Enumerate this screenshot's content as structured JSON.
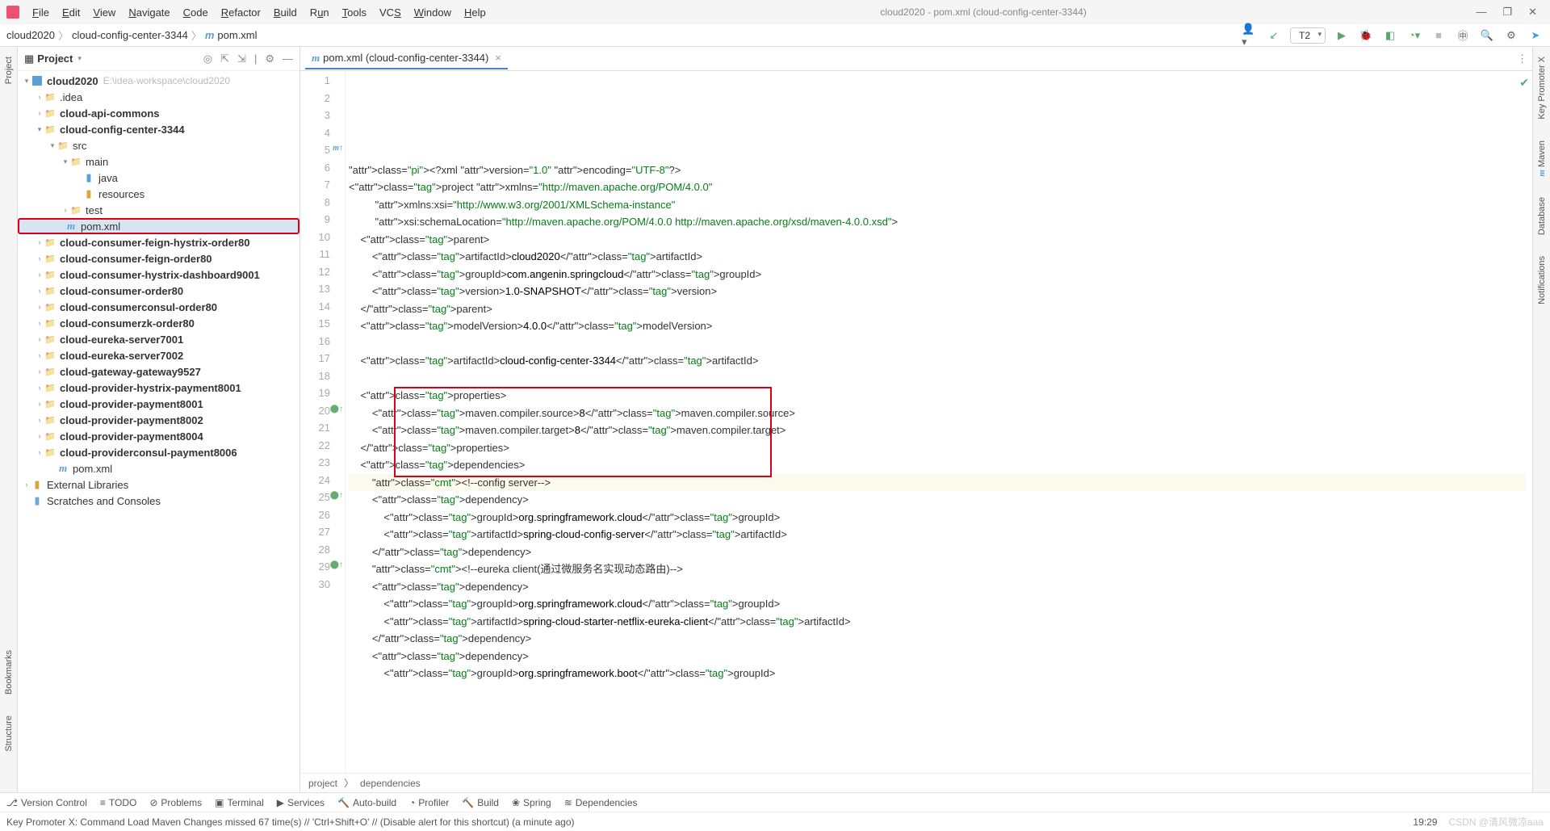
{
  "title": "cloud2020 - pom.xml (cloud-config-center-3344)",
  "menu": [
    "File",
    "Edit",
    "View",
    "Navigate",
    "Code",
    "Refactor",
    "Build",
    "Run",
    "Tools",
    "VCS",
    "Window",
    "Help"
  ],
  "breadcrumb": {
    "root": "cloud2020",
    "module": "cloud-config-center-3344",
    "file": "pom.xml"
  },
  "run_config": "T2",
  "project_label": "Project",
  "tree_root": "cloud2020",
  "tree_root_hint": "E:\\idea-workspace\\cloud2020",
  "tree": {
    "idea": ".idea",
    "api": "cloud-api-commons",
    "ccc": "cloud-config-center-3344",
    "src": "src",
    "main": "main",
    "java": "java",
    "resources": "resources",
    "test": "test",
    "pom": "pom.xml",
    "mods": [
      "cloud-consumer-feign-hystrix-order80",
      "cloud-consumer-feign-order80",
      "cloud-consumer-hystrix-dashboard9001",
      "cloud-consumer-order80",
      "cloud-consumerconsul-order80",
      "cloud-consumerzk-order80",
      "cloud-eureka-server7001",
      "cloud-eureka-server7002",
      "cloud-gateway-gateway9527",
      "cloud-provider-hystrix-payment8001",
      "cloud-provider-payment8001",
      "cloud-provider-payment8002",
      "cloud-provider-payment8004",
      "cloud-providerconsul-payment8006"
    ],
    "root_pom": "pom.xml",
    "ext": "External Libraries",
    "scratch": "Scratches and Consoles"
  },
  "tab": {
    "label": "pom.xml (cloud-config-center-3344)"
  },
  "breadcrumb_bottom": {
    "a": "project",
    "b": "dependencies"
  },
  "status_items": [
    "Version Control",
    "TODO",
    "Problems",
    "Terminal",
    "Services",
    "Auto-build",
    "Profiler",
    "Build",
    "Spring",
    "Dependencies"
  ],
  "status_msg": "Key Promoter X: Command Load Maven Changes missed 67 time(s) // 'Ctrl+Shift+O' // (Disable alert for this shortcut) (a minute ago)",
  "status_right": {
    "time": "19:29",
    "csdn": "CSDN @清风微凉aaa"
  },
  "right_tabs": [
    "Key Promoter X",
    "Maven",
    "Database",
    "Notifications"
  ],
  "left_tabs": [
    "Project",
    "Bookmarks",
    "Structure"
  ],
  "code": [
    "<?xml version=\"1.0\" encoding=\"UTF-8\"?>",
    "<project xmlns=\"http://maven.apache.org/POM/4.0.0\"",
    "         xmlns:xsi=\"http://www.w3.org/2001/XMLSchema-instance\"",
    "         xsi:schemaLocation=\"http://maven.apache.org/POM/4.0.0 http://maven.apache.org/xsd/maven-4.0.0.xsd\">",
    "    <parent>",
    "        <artifactId>cloud2020</artifactId>",
    "        <groupId>com.angenin.springcloud</groupId>",
    "        <version>1.0-SNAPSHOT</version>",
    "    </parent>",
    "    <modelVersion>4.0.0</modelVersion>",
    "",
    "    <artifactId>cloud-config-center-3344</artifactId>",
    "",
    "    <properties>",
    "        <maven.compiler.source>8</maven.compiler.source>",
    "        <maven.compiler.target>8</maven.compiler.target>",
    "    </properties>",
    "    <dependencies>",
    "        <!--config server-->",
    "        <dependency>",
    "            <groupId>org.springframework.cloud</groupId>",
    "            <artifactId>spring-cloud-config-server</artifactId>",
    "        </dependency>",
    "        <!--eureka client(通过微服务名实现动态路由)-->",
    "        <dependency>",
    "            <groupId>org.springframework.cloud</groupId>",
    "            <artifactId>spring-cloud-starter-netflix-eureka-client</artifactId>",
    "        </dependency>",
    "        <dependency>",
    "            <groupId>org.springframework.boot</groupId>"
  ]
}
